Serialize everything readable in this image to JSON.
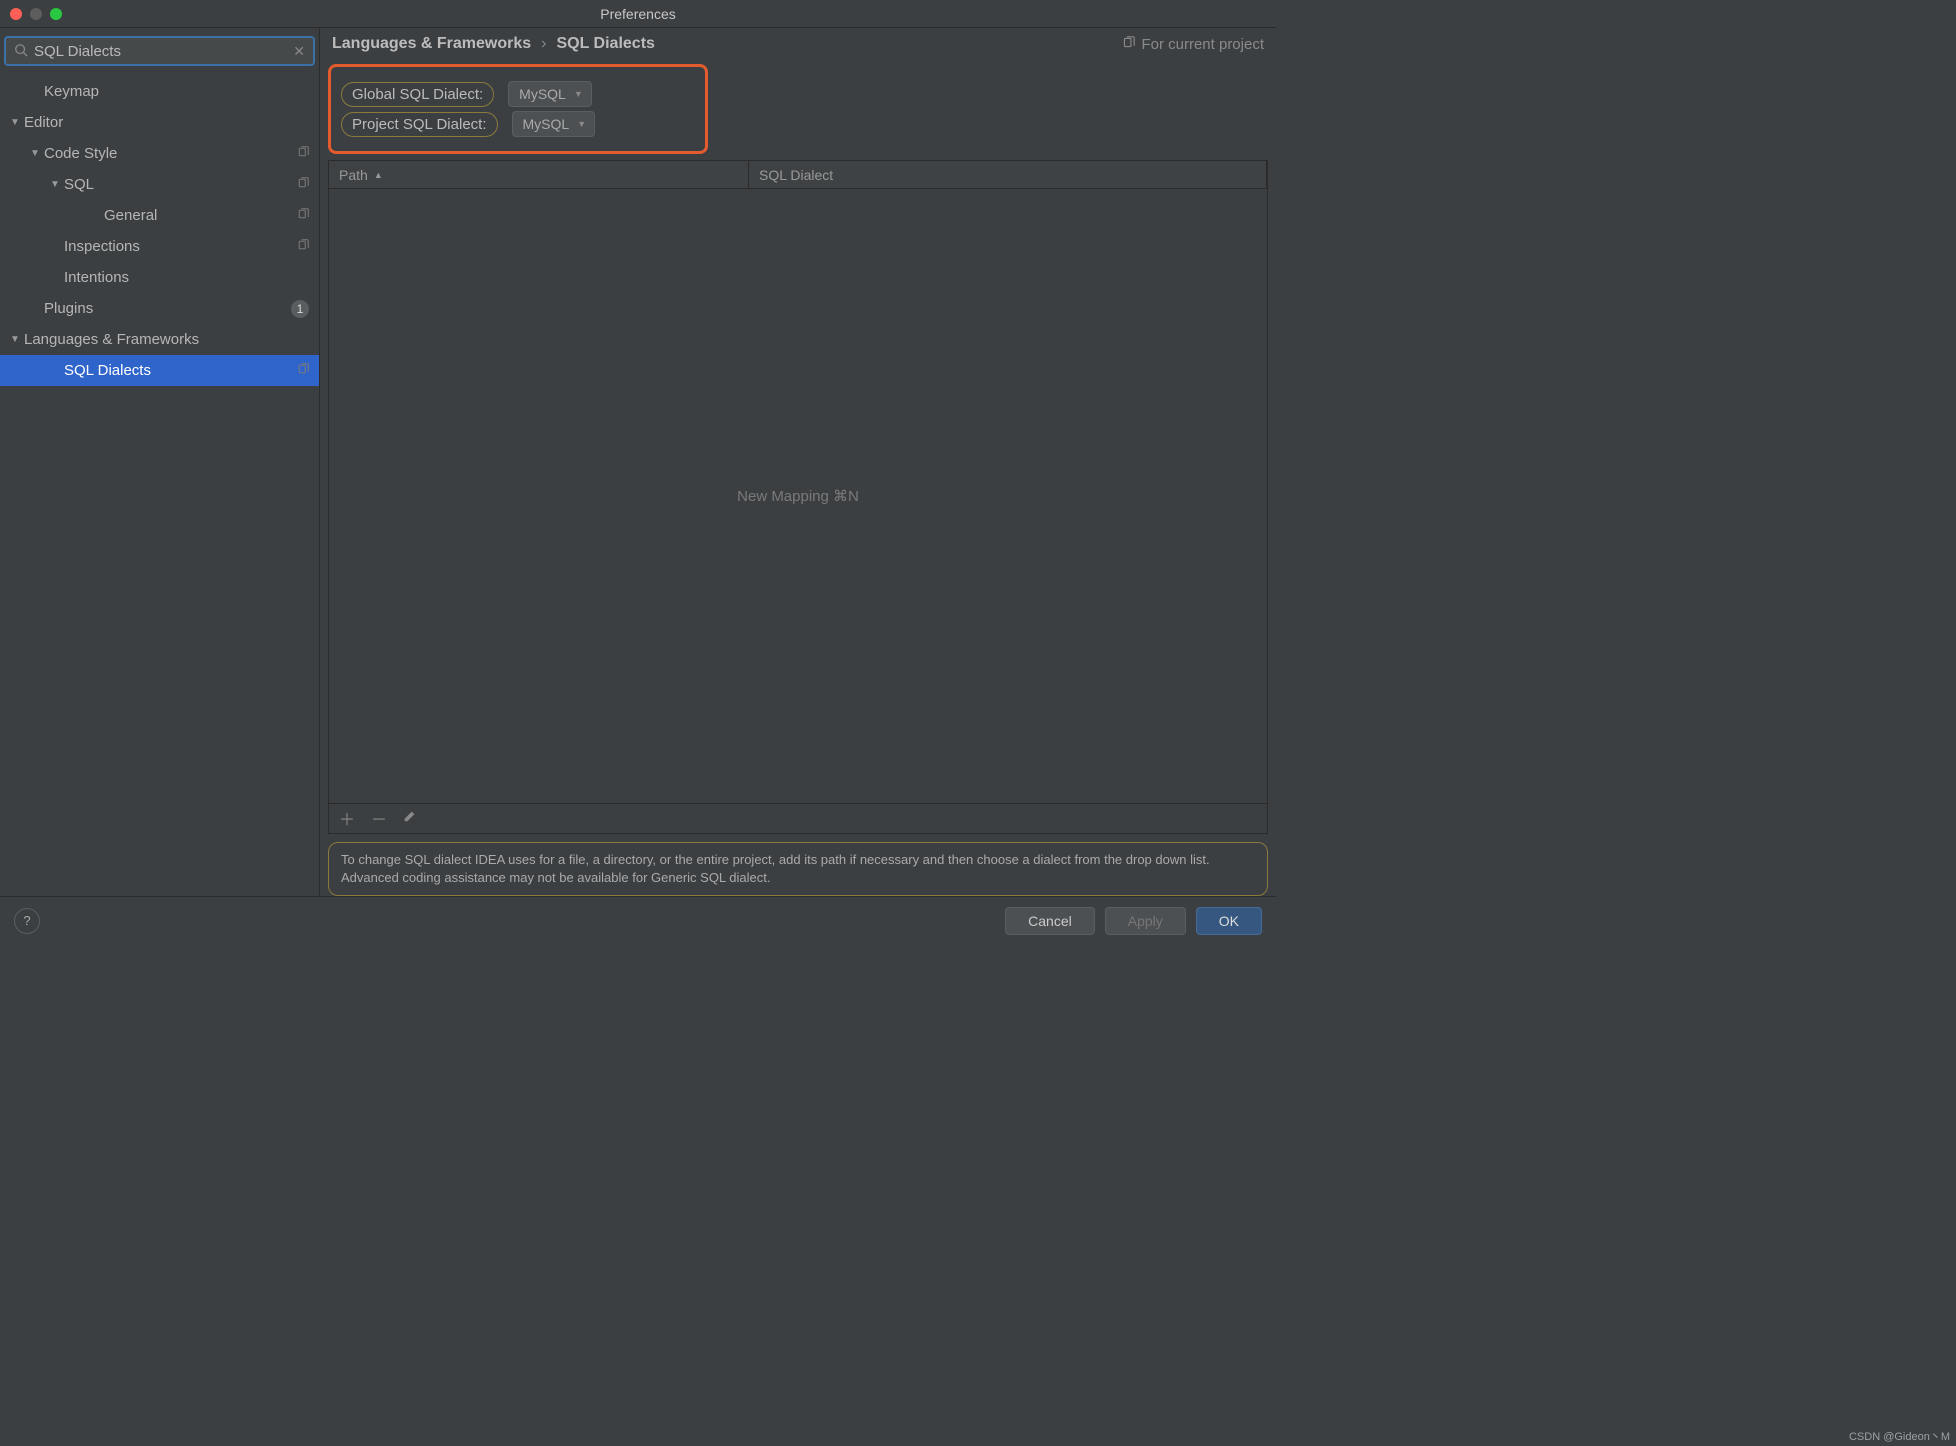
{
  "window": {
    "title": "Preferences"
  },
  "search": {
    "value": "SQL Dialects"
  },
  "sidebar": {
    "items": [
      {
        "label": "Keymap",
        "indent": 30,
        "chev": "",
        "icon": ""
      },
      {
        "label": "Editor",
        "indent": 10,
        "chev": "▼",
        "icon": ""
      },
      {
        "label": "Code Style",
        "indent": 30,
        "chev": "▼",
        "icon": "copy"
      },
      {
        "label": "SQL",
        "indent": 50,
        "chev": "▼",
        "icon": "copy"
      },
      {
        "label": "General",
        "indent": 90,
        "chev": "",
        "icon": "copy"
      },
      {
        "label": "Inspections",
        "indent": 50,
        "chev": "",
        "icon": "copy"
      },
      {
        "label": "Intentions",
        "indent": 50,
        "chev": "",
        "icon": ""
      },
      {
        "label": "Plugins",
        "indent": 30,
        "chev": "",
        "icon": "",
        "badge": "1"
      },
      {
        "label": "Languages & Frameworks",
        "indent": 10,
        "chev": "▼",
        "icon": ""
      },
      {
        "label": "SQL Dialects",
        "indent": 50,
        "chev": "",
        "icon": "copy",
        "selected": true
      }
    ]
  },
  "breadcrumb": {
    "parent": "Languages & Frameworks",
    "current": "SQL Dialects"
  },
  "scope": {
    "label": "For current project"
  },
  "settings": {
    "global_label": "Global SQL Dialect:",
    "global_value": "MySQL",
    "project_label": "Project SQL Dialect:",
    "project_value": "MySQL"
  },
  "table": {
    "col_path": "Path",
    "col_dialect": "SQL Dialect",
    "empty_text": "New Mapping ⌘N"
  },
  "help_text": "To change SQL dialect IDEA uses for a file, a directory, or the entire project, add its path if necessary and then choose a dialect from the drop down list. Advanced coding assistance may not be available for Generic SQL dialect.",
  "footer": {
    "cancel": "Cancel",
    "apply": "Apply",
    "ok": "OK"
  },
  "watermark": "CSDN @Gideon丶M"
}
